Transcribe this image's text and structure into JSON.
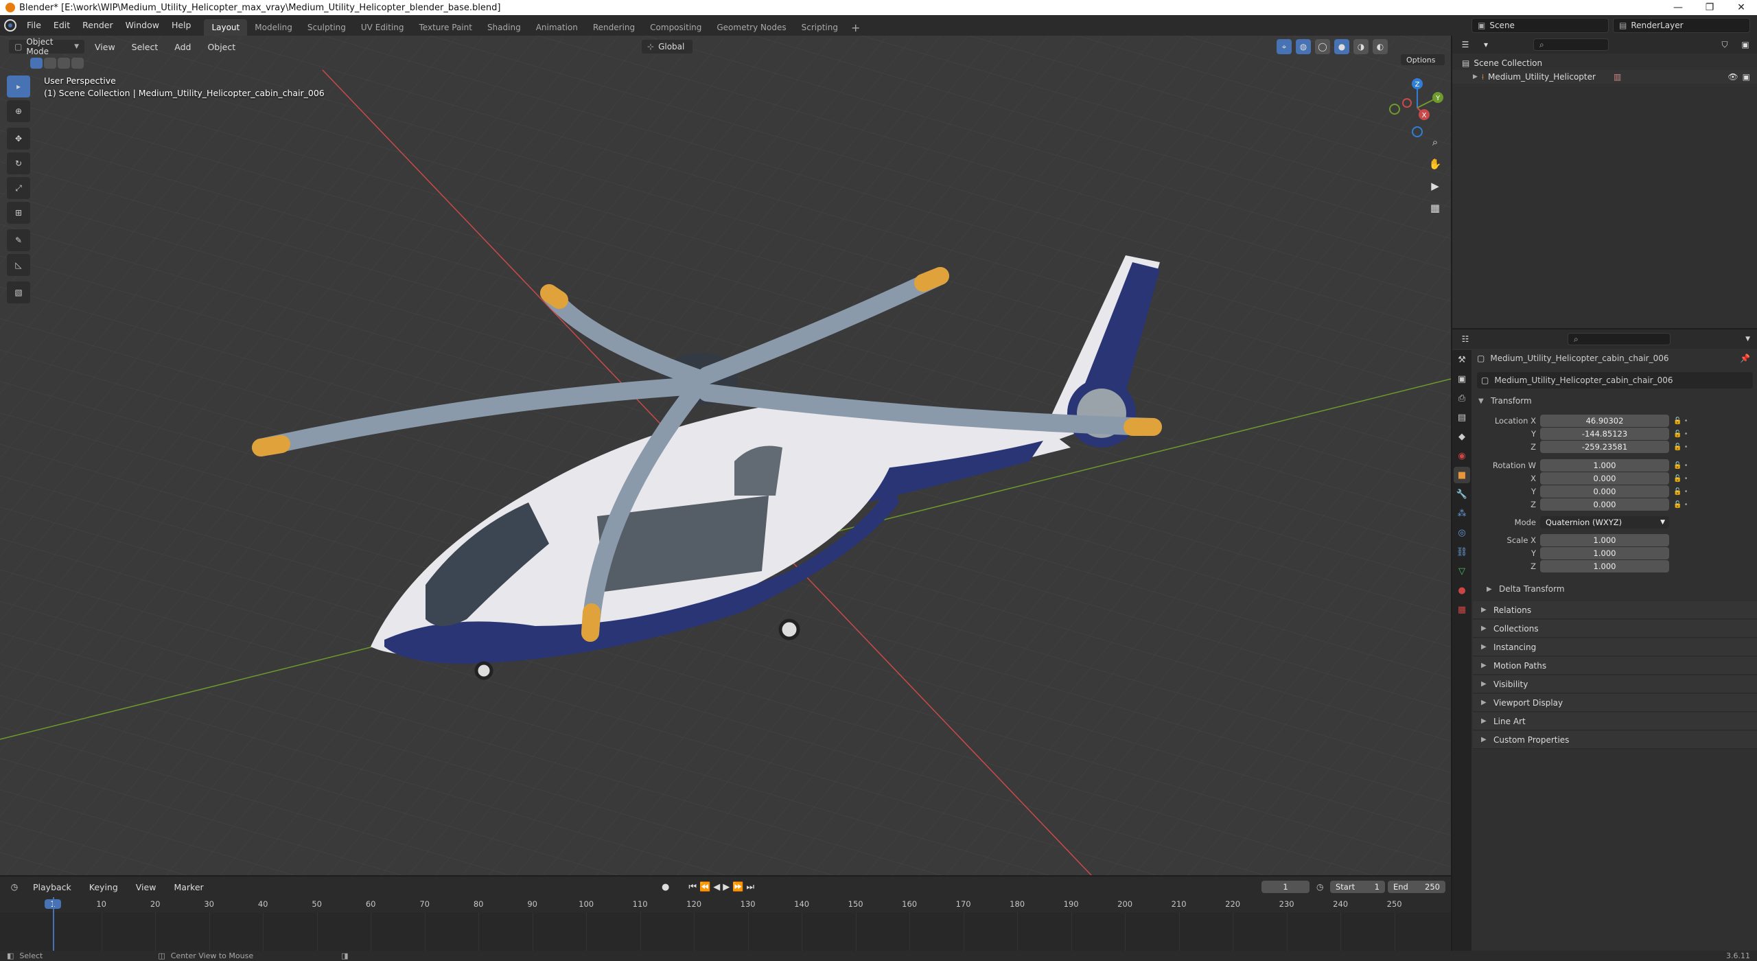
{
  "window": {
    "title": "Blender* [E:\\work\\WIP\\Medium_Utility_Helicopter_max_vray\\Medium_Utility_Helicopter_blender_base.blend]",
    "controls": [
      "—",
      "❐",
      "✕"
    ]
  },
  "menubar": {
    "items": [
      "File",
      "Edit",
      "Render",
      "Window",
      "Help"
    ],
    "workspaces": [
      "Layout",
      "Modeling",
      "Sculpting",
      "UV Editing",
      "Texture Paint",
      "Shading",
      "Animation",
      "Rendering",
      "Compositing",
      "Geometry Nodes",
      "Scripting"
    ],
    "active_workspace": "Layout",
    "scene": "Scene",
    "view_layer": "RenderLayer"
  },
  "viewport": {
    "mode": "Object Mode",
    "menus": [
      "View",
      "Select",
      "Add",
      "Object"
    ],
    "orientation": "Global",
    "options_label": "Options",
    "overlay_line1": "User Perspective",
    "overlay_line2": "(1) Scene Collection | Medium_Utility_Helicopter_cabin_chair_006",
    "gizmo": {
      "x": "X",
      "y": "Y",
      "z": "Z"
    }
  },
  "outliner": {
    "root": "Scene Collection",
    "items": [
      {
        "label": "Medium_Utility_Helicopter"
      }
    ]
  },
  "properties": {
    "object_name": "Medium_Utility_Helicopter_cabin_chair_006",
    "data_name": "Medium_Utility_Helicopter_cabin_chair_006",
    "transform_label": "Transform",
    "location": {
      "label": "Location X",
      "x": "46.90302",
      "y_label": "Y",
      "y": "-144.85123",
      "z_label": "Z",
      "z": "-259.23581"
    },
    "rotation": {
      "label": "Rotation W",
      "w": "1.000",
      "x_label": "X",
      "x": "0.000",
      "y_label": "Y",
      "y": "0.000",
      "z_label": "Z",
      "z": "0.000"
    },
    "mode": {
      "label": "Mode",
      "value": "Quaternion (WXYZ)"
    },
    "scale": {
      "label": "Scale X",
      "x": "1.000",
      "y_label": "Y",
      "y": "1.000",
      "z_label": "Z",
      "z": "1.000"
    },
    "delta_transform": "Delta Transform",
    "panels": [
      "Relations",
      "Collections",
      "Instancing",
      "Motion Paths",
      "Visibility",
      "Viewport Display",
      "Line Art",
      "Custom Properties"
    ]
  },
  "timeline": {
    "menus": [
      "Playback",
      "Keying",
      "View",
      "Marker"
    ],
    "current_frame": "1",
    "start_label": "Start",
    "start": "1",
    "end_label": "End",
    "end": "250",
    "ruler": [
      "1",
      "10",
      "20",
      "30",
      "40",
      "50",
      "60",
      "70",
      "80",
      "90",
      "100",
      "110",
      "120",
      "130",
      "140",
      "150",
      "160",
      "170",
      "180",
      "190",
      "200",
      "210",
      "220",
      "230",
      "240",
      "250"
    ]
  },
  "statusbar": {
    "select": "Select",
    "center": "Center View to Mouse",
    "version": "3.6.11"
  },
  "colors": {
    "accent": "#4772b3",
    "header": "#2b2b2b",
    "panel": "#303030",
    "viewport_bg": "#3a3a3a",
    "x_axis": "#c94a4a",
    "y_axis": "#6f9b2c",
    "heli_white": "#e8e8ec",
    "heli_blue": "#2a3576",
    "rotor_gray": "#8a9aaa",
    "rotor_tip": "#e0a23a"
  }
}
